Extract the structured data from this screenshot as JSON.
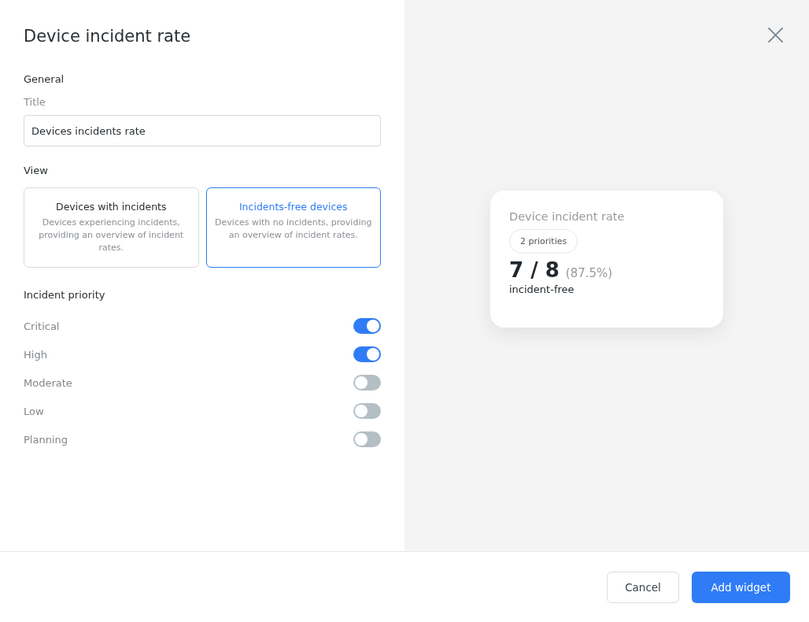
{
  "dialog": {
    "title": "Device incident rate"
  },
  "general": {
    "heading": "General",
    "title_label": "Title",
    "title_value": "Devices incidents rate"
  },
  "view": {
    "heading": "View",
    "options": [
      {
        "title": "Devices with incidents",
        "description": "Devices experiencing incidents, providing an overview of incident rates.",
        "selected": false
      },
      {
        "title": "Incidents-free devices",
        "description": "Devices with no incidents, providing an overview of incident rates.",
        "selected": true
      }
    ]
  },
  "incident_priority": {
    "heading": "Incident priority",
    "items": [
      {
        "label": "Critical",
        "on": true
      },
      {
        "label": "High",
        "on": true
      },
      {
        "label": "Moderate",
        "on": false
      },
      {
        "label": "Low",
        "on": false
      },
      {
        "label": "Planning",
        "on": false
      }
    ]
  },
  "preview": {
    "title": "Device incident rate",
    "badge": "2 priorities",
    "value": "7 / 8",
    "percent": "(87.5%)",
    "caption": "incident-free"
  },
  "buttons": [
    {
      "label": "Cancel",
      "kind": "secondary"
    },
    {
      "label": "Add widget",
      "kind": "primary"
    }
  ]
}
